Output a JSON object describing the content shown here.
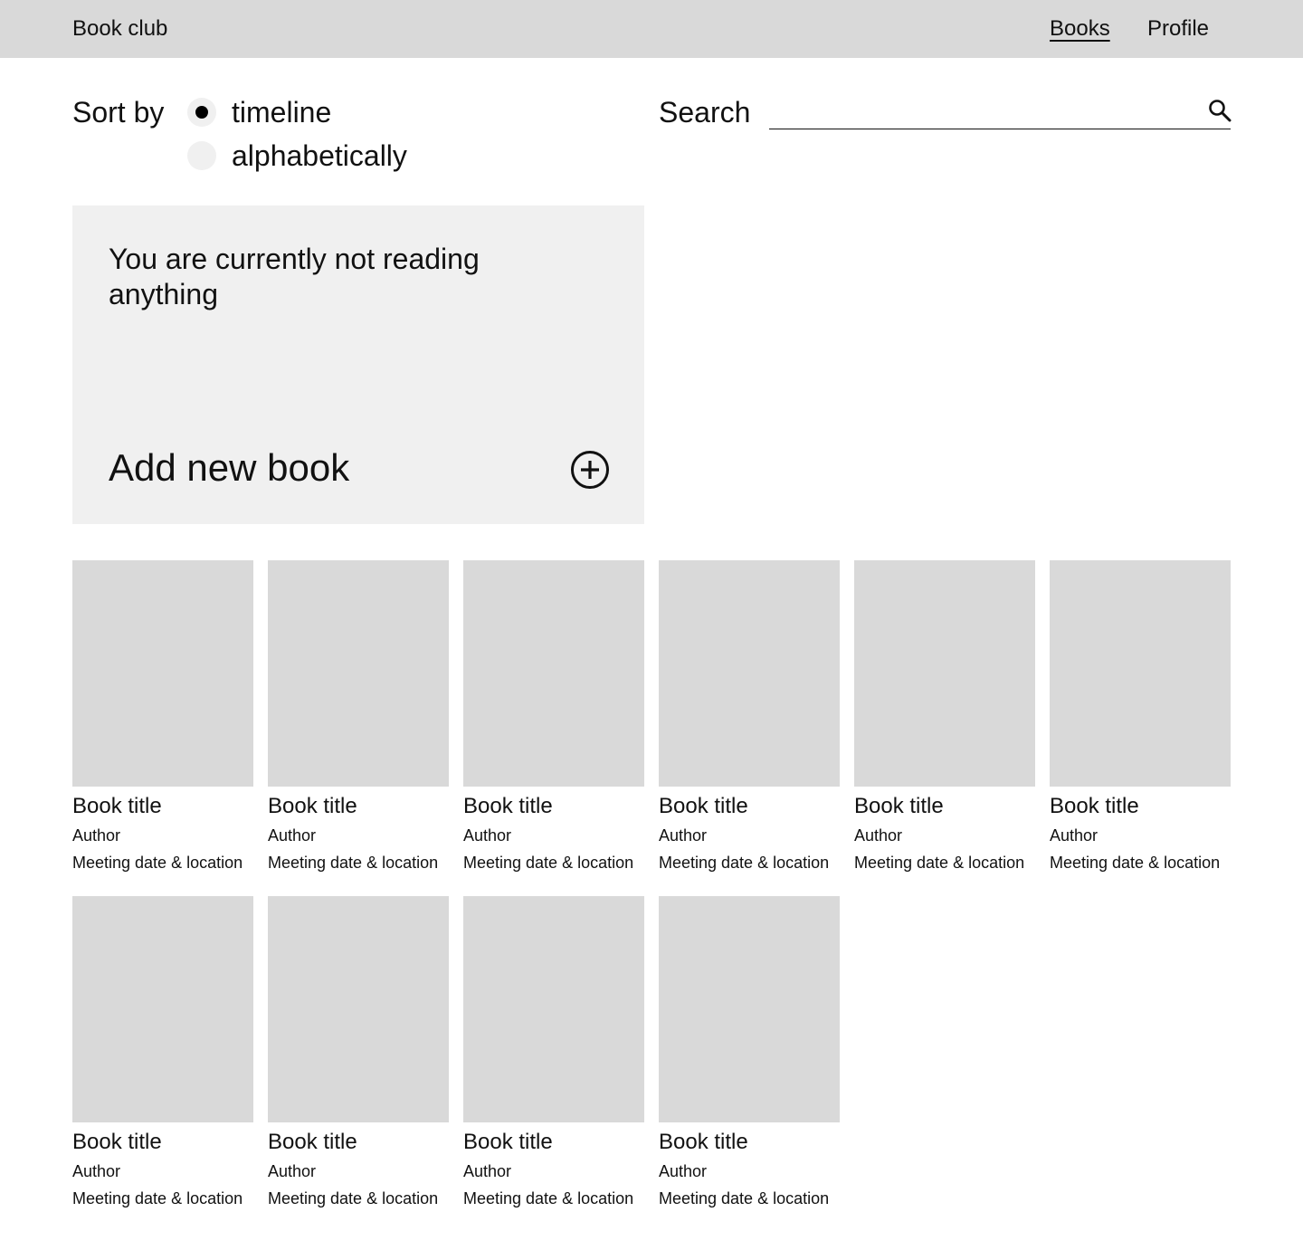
{
  "header": {
    "brand": "Book club",
    "nav": [
      {
        "label": "Books",
        "active": true
      },
      {
        "label": "Profile",
        "active": false
      }
    ]
  },
  "sort": {
    "label": "Sort by",
    "options": [
      {
        "label": "timeline",
        "checked": true
      },
      {
        "label": "alphabetically",
        "checked": false
      }
    ]
  },
  "search": {
    "label": "Search",
    "value": "",
    "icon": "search-icon"
  },
  "current_reading": {
    "status": "You are currently not reading anything",
    "add_label": "Add new book",
    "add_icon": "plus-circle-icon"
  },
  "books": [
    {
      "title": "Book title",
      "author": "Author",
      "meeting": "Meeting date & location"
    },
    {
      "title": "Book title",
      "author": "Author",
      "meeting": "Meeting date & location"
    },
    {
      "title": "Book title",
      "author": "Author",
      "meeting": "Meeting date & location"
    },
    {
      "title": "Book title",
      "author": "Author",
      "meeting": "Meeting date & location"
    },
    {
      "title": "Book title",
      "author": "Author",
      "meeting": "Meeting date & location"
    },
    {
      "title": "Book title",
      "author": "Author",
      "meeting": "Meeting date & location"
    },
    {
      "title": "Book title",
      "author": "Author",
      "meeting": "Meeting date & location"
    },
    {
      "title": "Book title",
      "author": "Author",
      "meeting": "Meeting date & location"
    },
    {
      "title": "Book title",
      "author": "Author",
      "meeting": "Meeting date & location"
    },
    {
      "title": "Book title",
      "author": "Author",
      "meeting": "Meeting date & location"
    }
  ],
  "colors": {
    "header_bg": "#d9d9d9",
    "card_bg": "#f0f0f0",
    "cover_placeholder": "#d9d9d9",
    "text": "#111111"
  }
}
